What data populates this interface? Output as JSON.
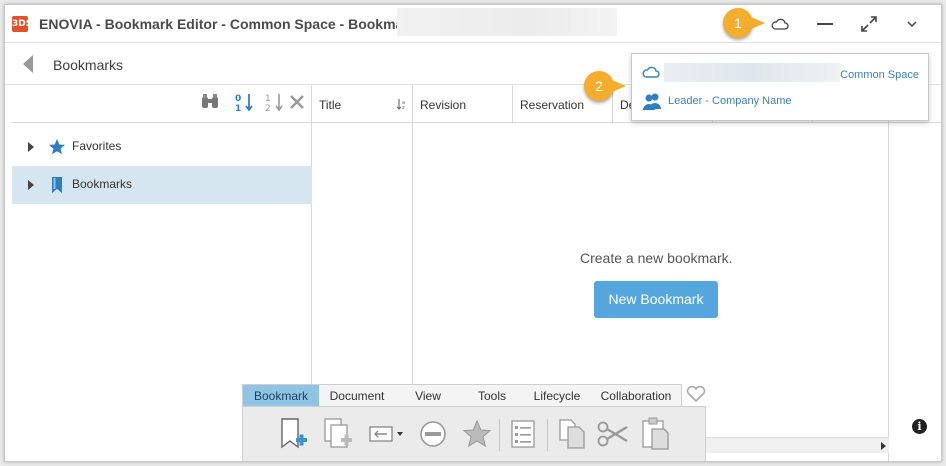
{
  "window": {
    "title": "ENOVIA - Bookmark Editor - Common Space - Bookmarks",
    "logo_text": "3DS"
  },
  "callouts": [
    "1",
    "2"
  ],
  "breadcrumb": {
    "label": "Bookmarks"
  },
  "tree": {
    "items": [
      {
        "label": "Favorites",
        "icon": "star-icon"
      },
      {
        "label": "Bookmarks",
        "icon": "bookmark-icon",
        "selected": true
      }
    ]
  },
  "grid": {
    "columns": [
      "Title",
      "Revision",
      "Reservation",
      "De"
    ]
  },
  "empty_state": {
    "message": "Create a new bookmark.",
    "button_label": "New Bookmark"
  },
  "context_panel": {
    "space": "Common Space",
    "role": "Leader - Company Name"
  },
  "action_bar": {
    "tabs": [
      "Bookmark",
      "Document",
      "View",
      "Tools",
      "Lifecycle",
      "Collaboration"
    ],
    "active_tab": "Bookmark",
    "icons": [
      "new-bookmark-icon",
      "add-to-bookmark-icon",
      "move-icon",
      "remove-icon",
      "favorite-icon",
      "properties-icon",
      "copy-icon",
      "cut-icon",
      "paste-icon"
    ]
  },
  "info_label": "i",
  "colors": {
    "accent": "#55a6dc",
    "selection": "#d6e6f1",
    "callout": "#f4ad2c",
    "active_tab": "#90c4e4",
    "link": "#3d7fb5",
    "brand": "#e0532a"
  }
}
